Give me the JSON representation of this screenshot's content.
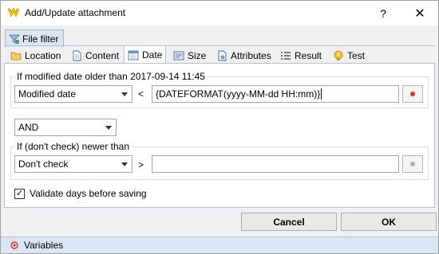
{
  "window": {
    "title": "Add/Update attachment",
    "help_glyph": "?",
    "close_glyph": "✕"
  },
  "outer_tab": {
    "label": "File filter",
    "icon": "funnel-icon"
  },
  "inner_tabs": [
    {
      "label": "Location",
      "icon": "folder-icon",
      "active": false
    },
    {
      "label": "Content",
      "icon": "document-icon",
      "active": false
    },
    {
      "label": "Date",
      "icon": "calendar-icon",
      "active": true
    },
    {
      "label": "Size",
      "icon": "size-icon",
      "active": false
    },
    {
      "label": "Attributes",
      "icon": "attributes-icon",
      "active": false
    },
    {
      "label": "Result",
      "icon": "list-icon",
      "active": false
    },
    {
      "label": "Test",
      "icon": "lightbulb-icon",
      "active": false
    }
  ],
  "group1": {
    "label": "If modified date older than 2017-09-14 11:45",
    "combo_value": "Modified date",
    "operator": "<",
    "text_value": "{DATEFORMAT(yyyy-MM-dd HH:mm)}",
    "dot_color": "#e03030"
  },
  "join_combo_value": "AND",
  "group2": {
    "label": "If (don't check) newer than",
    "combo_value": "Don't check",
    "operator": ">",
    "text_value": "",
    "dot_color": "#b0b0b0"
  },
  "validate": {
    "label": "Validate days before saving",
    "checked": true,
    "check_glyph": "✓"
  },
  "buttons": {
    "cancel": "Cancel",
    "ok": "OK"
  },
  "statusbar": {
    "label": "Variables",
    "icon_color": "#e03030"
  }
}
